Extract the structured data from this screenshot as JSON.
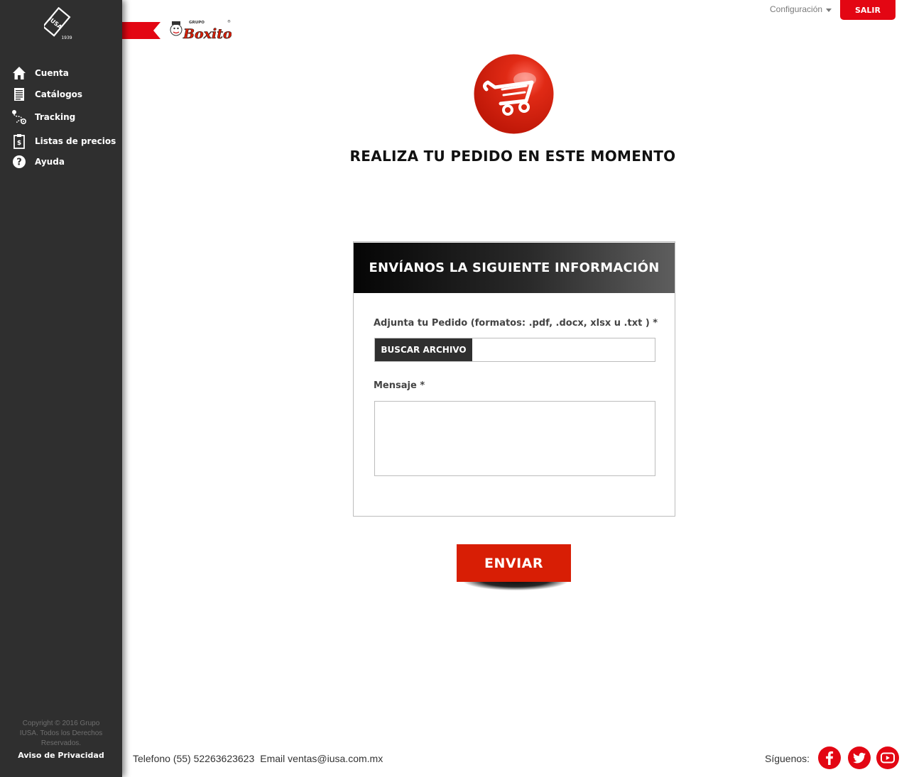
{
  "sidebar": {
    "logo": {
      "text": "IUSA",
      "year": "1939"
    },
    "items": [
      {
        "label": "Cuenta",
        "icon": "home-icon"
      },
      {
        "label": "Catálogos",
        "icon": "document-icon"
      },
      {
        "label": "Tracking",
        "icon": "route-icon"
      },
      {
        "label": "Listas de precios",
        "icon": "price-list-icon"
      },
      {
        "label": "Ayuda",
        "icon": "help-icon"
      }
    ],
    "copyright": "Copyright © 2016 Grupo IUSA. Todos los Derechos Reservados.",
    "privacy_link": "Aviso de Privacidad"
  },
  "header": {
    "brand": {
      "prefix": "GRUPO",
      "name": "Boxito"
    },
    "config_label": "Configuración",
    "logout_label": "SALIR"
  },
  "main": {
    "title": "REALIZA TU PEDIDO EN ESTE MOMENTO",
    "form": {
      "header": "ENVÍANOS LA SIGUIENTE INFORMACIÓN",
      "attach_label": "Adjunta tu Pedido (formatos: .pdf, .docx, xlsx u .txt ) *",
      "file_button": "BUSCAR ARCHIVO",
      "file_value": "",
      "message_label": "Mensaje *",
      "message_value": ""
    },
    "submit_label": "ENVIAR"
  },
  "footer": {
    "phone": "Telefono (55) 52263623623",
    "email": "Email ventas@iusa.com.mx",
    "follow_label": "Síguenos:",
    "social": [
      "facebook-icon",
      "twitter-icon",
      "youtube-icon"
    ]
  },
  "colors": {
    "sidebar_bg": "#2f2f2f",
    "accent_red": "#e30613",
    "submit_red": "#d81e05"
  }
}
